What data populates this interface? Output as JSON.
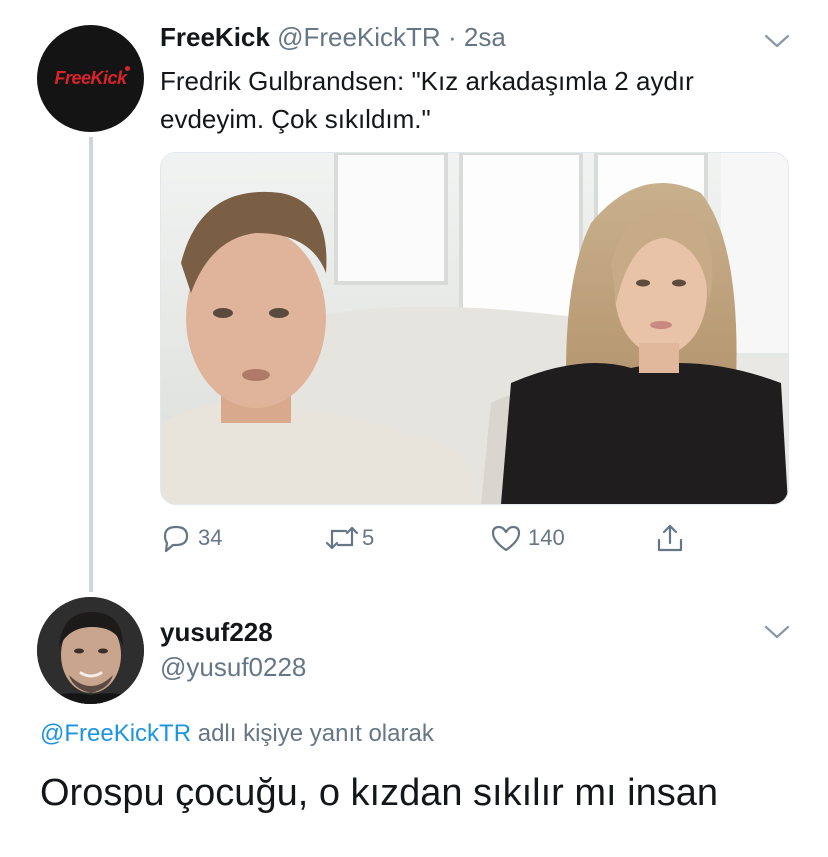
{
  "tweet": {
    "avatar_logo": "FreeKick",
    "author_name": "FreeKick",
    "author_handle": "@FreeKickTR",
    "separator": "·",
    "time": "2sa",
    "text": "Fredrik Gulbrandsen: \"Kız arkadaşımla 2 aydır evdeyim. Çok sıkıldım.\"",
    "actions": {
      "reply_icon": "reply-icon",
      "reply_count": "34",
      "retweet_icon": "retweet-icon",
      "retweet_count": "5",
      "like_icon": "heart-icon",
      "like_count": "140",
      "share_icon": "share-icon"
    }
  },
  "reply": {
    "author_name": "yusuf228",
    "author_handle": "@yusuf0228",
    "replying_to_mention": "@FreeKickTR",
    "replying_to_suffix": " adlı kişiye yanıt olarak",
    "text": "Orospu çocuğu, o kızdan sıkılır mı insan"
  },
  "colors": {
    "text": "#14171a",
    "secondary": "#657786",
    "link": "#1b95e0",
    "thread_line": "#ccd6dd",
    "logo_red": "#d8232a"
  }
}
